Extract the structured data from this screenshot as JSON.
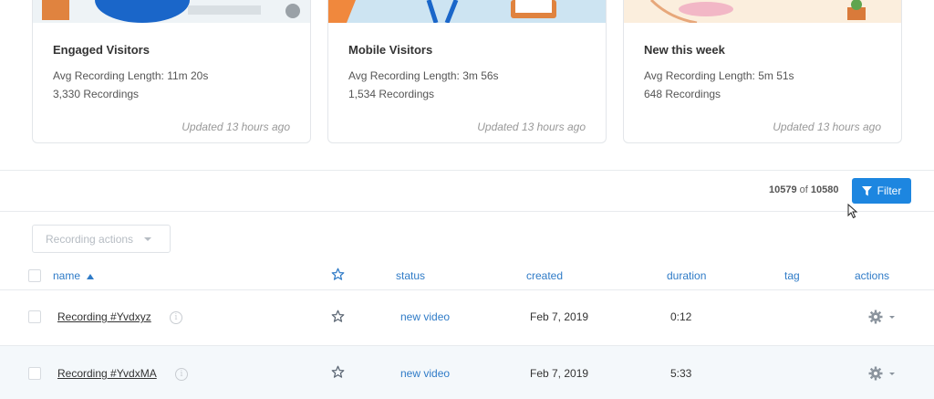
{
  "cards": [
    {
      "title": "Engaged Visitors",
      "avg": "Avg Recording Length: 11m 20s",
      "count": "3,330 Recordings",
      "updated": "Updated 13 hours ago"
    },
    {
      "title": "Mobile Visitors",
      "avg": "Avg Recording Length: 3m 56s",
      "count": "1,534 Recordings",
      "updated": "Updated 13 hours ago"
    },
    {
      "title": "New this week",
      "avg": "Avg Recording Length: 5m 51s",
      "count": "648 Recordings",
      "updated": "Updated 13 hours ago"
    }
  ],
  "toolbar": {
    "shown": "10579",
    "of": "of",
    "total": "10580",
    "filter_label": "Filter",
    "actions_label": "Recording actions"
  },
  "table": {
    "headers": {
      "name": "name",
      "status": "status",
      "created": "created",
      "duration": "duration",
      "tag": "tag",
      "actions": "actions"
    },
    "rows": [
      {
        "name": "Recording #Yvdxyz",
        "status": "new video",
        "created": "Feb 7, 2019",
        "duration": "0:12"
      },
      {
        "name": "Recording #YvdxMA",
        "status": "new video",
        "created": "Feb 7, 2019",
        "duration": "5:33"
      }
    ]
  },
  "colors": {
    "accent": "#1d86e0",
    "link": "#2f7bc7"
  }
}
